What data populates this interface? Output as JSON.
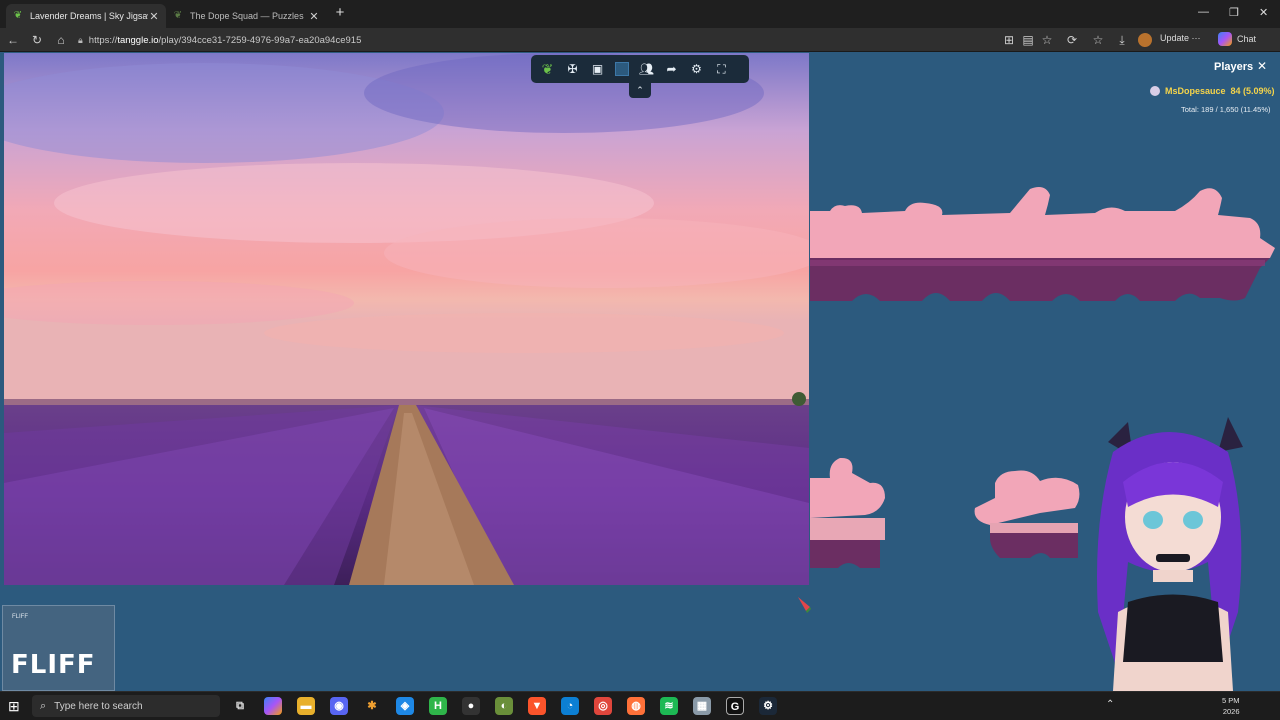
{
  "browser": {
    "tabs": [
      {
        "title": "Lavender Dreams | Sky Jigsaw",
        "active": true
      },
      {
        "title": "The Dope Squad — Puzzles",
        "active": false
      }
    ],
    "url_prefix": "https://",
    "url_host": "tanggle.io",
    "url_path": "/play/394cce31-7259-4976-99a7-ea20a94ce915",
    "update_label": "Update",
    "chat_label": "Chat"
  },
  "game": {
    "toolbar_icons": [
      "logo-icon",
      "puzzle-piece-icon",
      "image-preview-icon",
      "background-color-swatch",
      "players-icon",
      "share-icon",
      "settings-icon",
      "fullscreen-icon"
    ],
    "background_color": "#2c5a7e",
    "players_panel": {
      "title": "Players",
      "player_name": "MsDopesauce",
      "player_score": "84 (5.09%)",
      "total": "Total: 189 / 1,650 (11.45%)"
    }
  },
  "overlay": {
    "sponsor_logo": "FLIFF",
    "sponsor_small": "FLIFF"
  },
  "taskbar": {
    "search_placeholder": "Type here to search",
    "clock_time": "5 PM",
    "clock_date": "2026"
  },
  "colors": {
    "accent_yellow": "#f5d44a",
    "board_blue": "#2c5a7e",
    "toolbar_dark": "#1b2b3a"
  }
}
